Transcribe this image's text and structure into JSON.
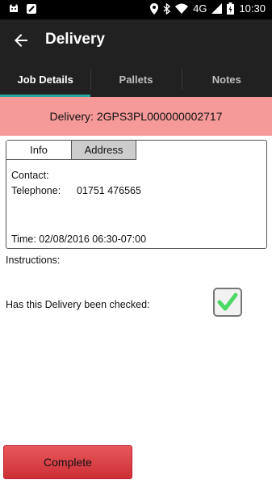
{
  "status_bar": {
    "time": "10:30",
    "network": "4G",
    "left_icons": [
      "cat-notification-icon",
      "map-notification-icon"
    ],
    "right_icons": [
      "location-icon",
      "bluetooth-icon",
      "wifi-icon",
      "signal-icon",
      "battery-charging-icon"
    ]
  },
  "app_bar": {
    "title": "Delivery",
    "back_icon": "arrow-left-icon"
  },
  "tabs": [
    {
      "label": "Job Details",
      "active": true
    },
    {
      "label": "Pallets",
      "active": false
    },
    {
      "label": "Notes",
      "active": false
    }
  ],
  "banner": {
    "text": "Delivery: 2GPS3PL000000002717",
    "color": "#f59999"
  },
  "card": {
    "subtabs": [
      {
        "label": "Info",
        "selected": true
      },
      {
        "label": "Address",
        "selected": false
      }
    ],
    "contact_label": "Contact:",
    "telephone_label": "Telephone:",
    "telephone_value": "01751 476565",
    "time_text": "Time: 02/08/2016 06:30-07:00"
  },
  "instructions_label": "Instructions:",
  "checked_question": "Has this Delivery been checked:",
  "checked": true,
  "check_color": "#4cd964",
  "complete_button": "Complete",
  "colors": {
    "app_bar": "#212121",
    "tab_indicator": "#26a69a",
    "complete_button": "#d9414a"
  }
}
